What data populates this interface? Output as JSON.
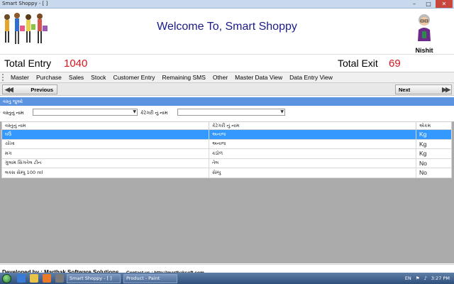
{
  "window": {
    "title": "Smart Shoppy - [ ]"
  },
  "header": {
    "welcome": "Welcome To, Smart Shoppy",
    "username": "Nishit"
  },
  "totals": {
    "entry_label": "Total Entry",
    "entry_value": "1040",
    "exit_label": "Total Exit",
    "exit_value": "69"
  },
  "menu": [
    "Master",
    "Purchase",
    "Sales",
    "Stock",
    "Customer Entry",
    "Remaining SMS",
    "Other",
    "Master Data View",
    "Data Entry View"
  ],
  "nav": {
    "previous": "Previous",
    "next": "Next"
  },
  "search": {
    "header": "વસ્તુ જુઓ",
    "item_label": "વસ્તુનું નામ",
    "category_label": "કેટેગરી નું નામ",
    "item_value": "",
    "category_value": ""
  },
  "table": {
    "columns": [
      "વસ્તુનું નામ",
      "કેટેગરી નું નામ",
      "એકમ"
    ],
    "rows": [
      {
        "name": "ઘઉં",
        "category": "અનાજ",
        "unit": "Kg",
        "selected": true
      },
      {
        "name": "ચોખા",
        "category": "અનાજ",
        "unit": "Kg",
        "selected": false
      },
      {
        "name": "મગ",
        "category": "કઠોળ",
        "unit": "Kg",
        "selected": false
      },
      {
        "name": "ગુલામ સિંગતેલ ટીન",
        "category": "તેલ",
        "unit": "No",
        "selected": false
      },
      {
        "name": "લક્સ સેમ્પુ 100 ml",
        "category": "સેમ્પુ",
        "unit": "No",
        "selected": false
      }
    ]
  },
  "footer": {
    "developed_by": "Developed by : Marthak Software Solutions",
    "contact": "Contact us : http://marthaksoft.com"
  },
  "taskbar": {
    "tasks": [
      "Smart Shoppy - [ ]",
      "Product - Paint"
    ],
    "lang": "EN",
    "time": "3:27 PM"
  },
  "colors": {
    "accent": "#5b93e0",
    "selected_row": "#3399ff",
    "totals_value": "#d9161c",
    "title": "#1a1a8a"
  }
}
